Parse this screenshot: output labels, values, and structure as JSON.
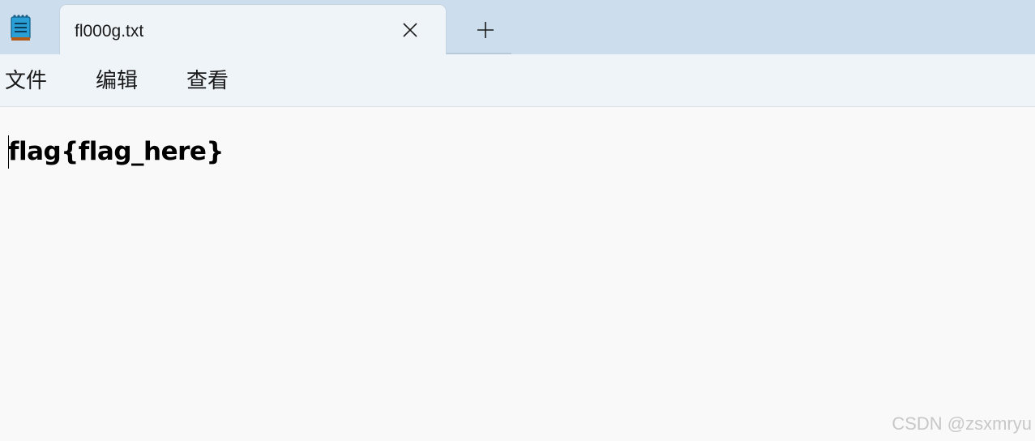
{
  "tab": {
    "title": "fl000g.txt",
    "close_icon": "close-icon",
    "new_tab_icon": "plus-icon"
  },
  "app_icon": "notepad-icon",
  "menu": {
    "items": [
      {
        "label": "文件"
      },
      {
        "label": "编辑"
      },
      {
        "label": "查看"
      }
    ]
  },
  "editor": {
    "content": "flag{flag_here}"
  },
  "watermark": "CSDN @zsxmryu",
  "colors": {
    "titlebar_bg": "#ccdeed",
    "tab_bg": "#eff4f9",
    "editor_bg": "#f9f9f9",
    "icon_blue": "#2a9fd6"
  }
}
